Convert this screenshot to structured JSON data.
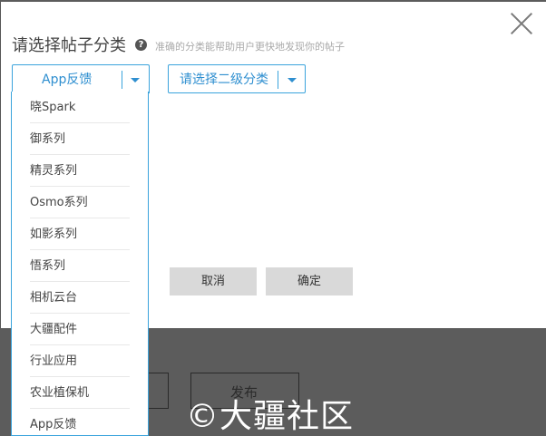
{
  "dialog": {
    "title": "请选择帖子分类",
    "help_icon_glyph": "?",
    "hint": "准确的分类能帮助用户更快地发现你的帖子",
    "close_icon": "close-icon"
  },
  "primary_select": {
    "value": "App反馈"
  },
  "secondary_select": {
    "placeholder": "请选择二级分类"
  },
  "dropdown": {
    "items": [
      "晓Spark",
      "御系列",
      "精灵系列",
      "Osmo系列",
      "如影系列",
      "悟系列",
      "相机云台",
      "大疆配件",
      "行业应用",
      "农业植保机",
      "App反馈"
    ]
  },
  "buttons": {
    "cancel": "取消",
    "confirm": "确定"
  },
  "background": {
    "publish": "发布"
  },
  "watermark": "©大疆社区"
}
